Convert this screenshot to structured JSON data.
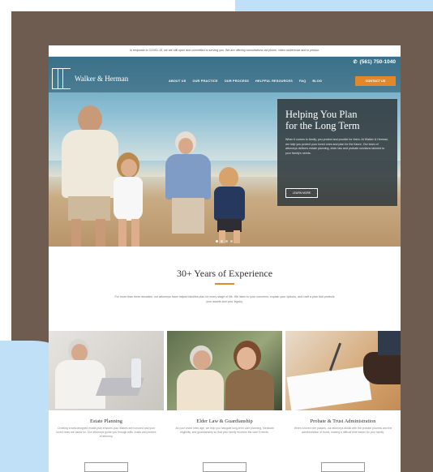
{
  "notice": "In response to COVID-19, we are still open and committed to serving you. We are offering consultations via phone, video conference and in person.",
  "logo": {
    "mark": "WH",
    "name": "Walker & Herman"
  },
  "phone": {
    "icon": "phone-icon",
    "number": "(561) 750-1040"
  },
  "nav": [
    {
      "label": "ABOUT US"
    },
    {
      "label": "OUR PRACTICE"
    },
    {
      "label": "OUR PROCESS"
    },
    {
      "label": "HELPFUL RESOURCES"
    },
    {
      "label": "FAQ"
    },
    {
      "label": "BLOG"
    }
  ],
  "contact_button": "CONTACT US",
  "hero": {
    "title_line1": "Helping You Plan",
    "title_line2": "for the Long Term",
    "body": "When it comes to family, you protect and provide for them. At Walker & Herman, we help you protect your loved ones and plan for the future. Our team of attorneys delivers estate planning, elder law and probate solutions tailored to your family's needs.",
    "cta": "LEARN MORE",
    "slides": 4,
    "active_slide": 1
  },
  "section": {
    "title": "30+ Years of Experience",
    "intro": "For more than three decades, our attorneys have helped families plan for every stage of life. We listen to your concerns, explain your options, and craft a plan that protects your assets and your legacy."
  },
  "cards": [
    {
      "title": "Estate Planning",
      "body": "Creating a well-designed estate plan ensures your wishes are honored and your loved ones are cared for. Our attorneys guide you through wills, trusts and powers of attorney.",
      "button": ""
    },
    {
      "title": "Elder Law & Guardianship",
      "body": "As your loved ones age, we help you navigate long-term care planning, Medicaid eligibility, and guardianship so that your family receives the care it needs.",
      "button": ""
    },
    {
      "title": "Probate & Trust Administration",
      "body": "When a loved one passes, our attorneys assist with the probate process and the administration of trusts, making a difficult time easier for your family.",
      "button": ""
    }
  ],
  "colors": {
    "frame": "#6e5c50",
    "accent": "#e1892a",
    "overlay": "#303a3e"
  }
}
